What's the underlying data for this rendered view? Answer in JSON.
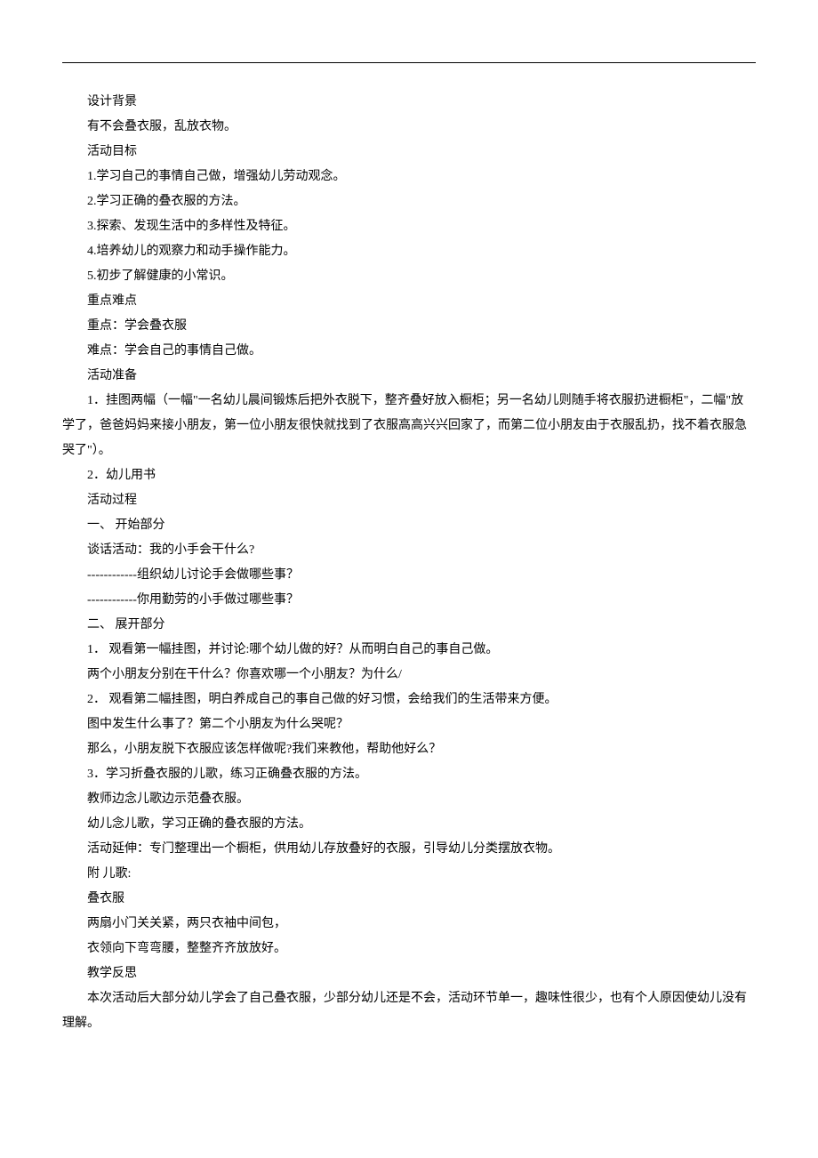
{
  "lines": [
    "设计背景",
    "有不会叠衣服，乱放衣物。",
    "活动目标",
    "1.学习自己的事情自己做，增强幼儿劳动观念。",
    "2.学习正确的叠衣服的方法。",
    "3.探索、发现生活中的多样性及特征。",
    "4.培养幼儿的观察力和动手操作能力。",
    "5.初步了解健康的小常识。",
    "重点难点",
    "重点：学会叠衣服",
    "难点：学会自己的事情自己做。",
    "活动准备",
    "1．挂图两幅（一幅\"一名幼儿晨间锻炼后把外衣脱下，整齐叠好放入橱柜；另一名幼儿则随手将衣服扔进橱柜\"，二幅\"放学了，爸爸妈妈来接小朋友，第一位小朋友很快就找到了衣服高高兴兴回家了，而第二位小朋友由于衣服乱扔，找不着衣服急哭了\"）。",
    "2．幼儿用书",
    "活动过程",
    "一、 开始部分",
    "谈话活动：我的小手会干什么?",
    "------------组织幼儿讨论手会做哪些事？",
    "------------你用勤劳的小手做过哪些事？",
    "二、 展开部分",
    "1． 观看第一幅挂图，并讨论:哪个幼儿做的好？从而明白自己的事自己做。",
    "两个小朋友分别在干什么？你喜欢哪一个小朋友？为什么/",
    "2． 观看第二幅挂图，明白养成自己的事自己做的好习惯，会给我们的生活带来方便。",
    "图中发生什么事了？第二个小朋友为什么哭呢？",
    "那么，小朋友脱下衣服应该怎样做呢?我们来教他，帮助他好么？",
    "3．学习折叠衣服的儿歌，练习正确叠衣服的方法。",
    "教师边念儿歌边示范叠衣服。",
    "幼儿念儿歌，学习正确的叠衣服的方法。",
    "活动延伸：专门整理出一个橱柜，供用幼儿存放叠好的衣服，引导幼儿分类摆放衣物。",
    "附 儿歌:",
    "叠衣服",
    "两扇小门关关紧，两只衣袖中间包，",
    "衣领向下弯弯腰，整整齐齐放放好。",
    "教学反思",
    "本次活动后大部分幼儿学会了自己叠衣服，少部分幼儿还是不会，活动环节单一，趣味性很少，也有个人原因使幼儿没有理解。"
  ]
}
